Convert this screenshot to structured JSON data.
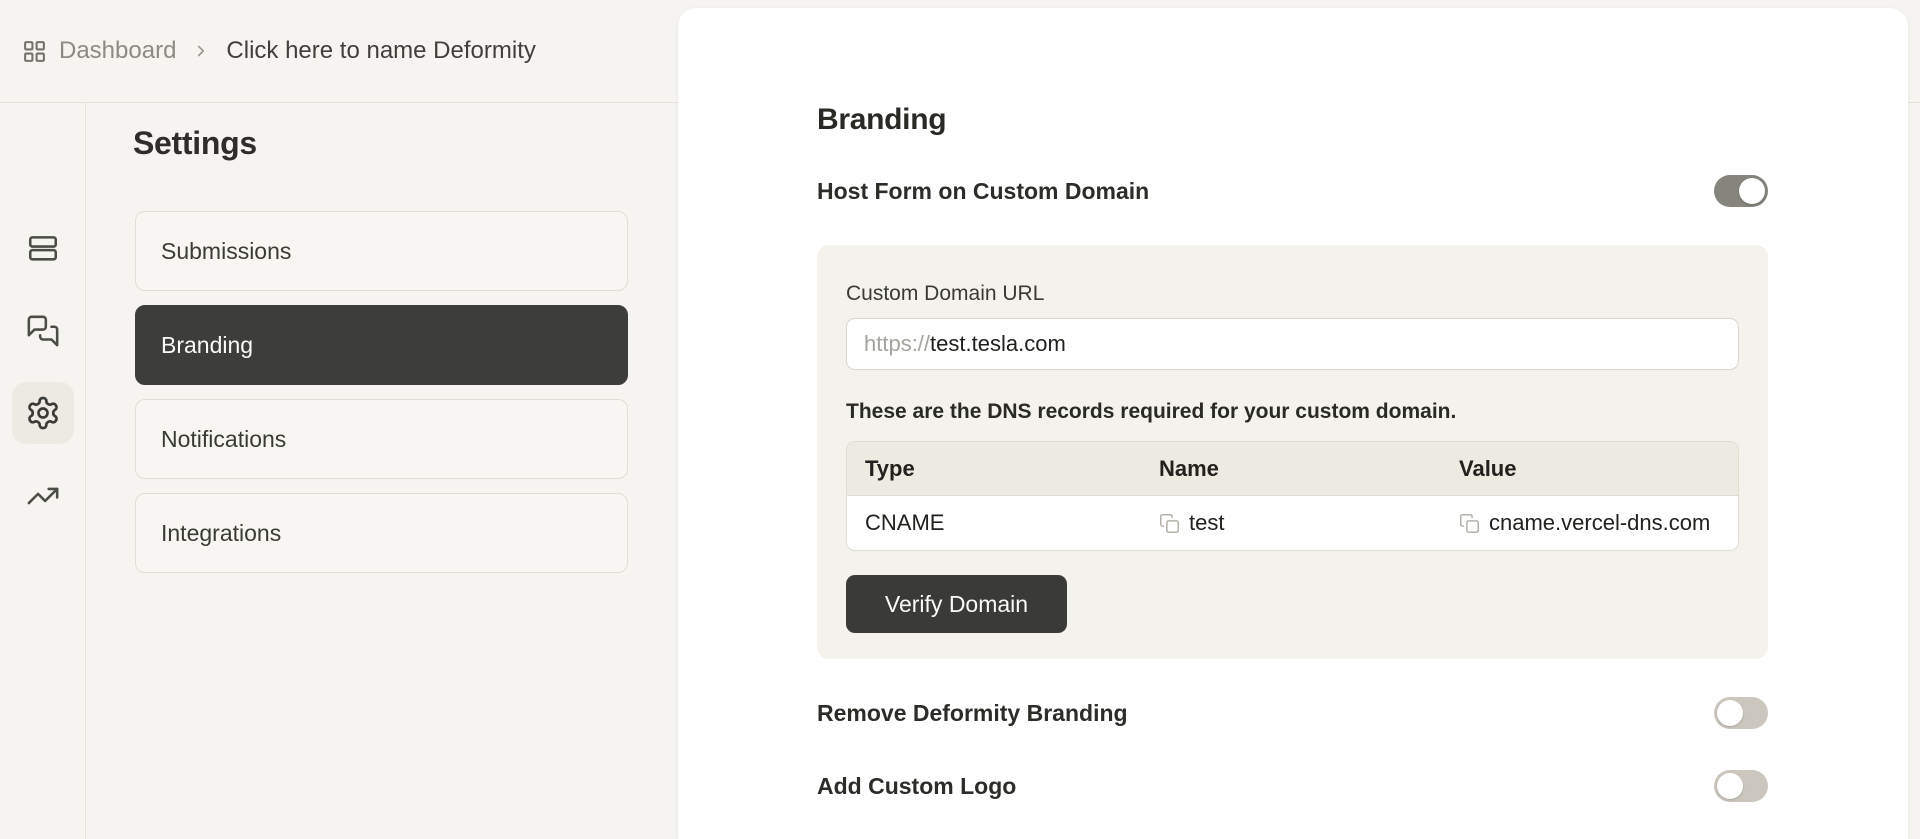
{
  "breadcrumb": {
    "dashboard_label": "Dashboard",
    "form_title": "Click here to name Deformity"
  },
  "sidebar": {
    "items": [
      {
        "name": "form-builder",
        "icon": "rows-icon",
        "active": false
      },
      {
        "name": "conversations",
        "icon": "chat-icon",
        "active": false
      },
      {
        "name": "settings",
        "icon": "gear-icon",
        "active": true
      },
      {
        "name": "analytics",
        "icon": "trending-up-icon",
        "active": false
      }
    ]
  },
  "settings_nav": {
    "title": "Settings",
    "items": [
      {
        "label": "Submissions",
        "active": false
      },
      {
        "label": "Branding",
        "active": true
      },
      {
        "label": "Notifications",
        "active": false
      },
      {
        "label": "Integrations",
        "active": false
      }
    ]
  },
  "main": {
    "title": "Branding",
    "host_custom_domain": {
      "label": "Host Form on Custom Domain",
      "enabled": true
    },
    "custom_domain": {
      "url_label": "Custom Domain URL",
      "url_prefix": "https://",
      "url_value": "test.tesla.com",
      "dns_note": "These are the DNS records required for your custom domain.",
      "dns_table": {
        "headers": {
          "type": "Type",
          "name": "Name",
          "value": "Value"
        },
        "row": {
          "type": "CNAME",
          "name": "test",
          "value": "cname.vercel-dns.com"
        }
      },
      "verify_button": "Verify Domain"
    },
    "remove_branding": {
      "label": "Remove Deformity Branding",
      "enabled": false
    },
    "add_custom_logo": {
      "label": "Add Custom Logo",
      "enabled": false
    }
  },
  "colors": {
    "background": "#f5f4f0",
    "card": "#ffffff",
    "accent_dark": "#3d3d3a",
    "toggle_on": "#85857d",
    "toggle_off": "#cbc7bf",
    "section_bg": "#f4f2ec",
    "table_header_bg": "#eceae1"
  }
}
